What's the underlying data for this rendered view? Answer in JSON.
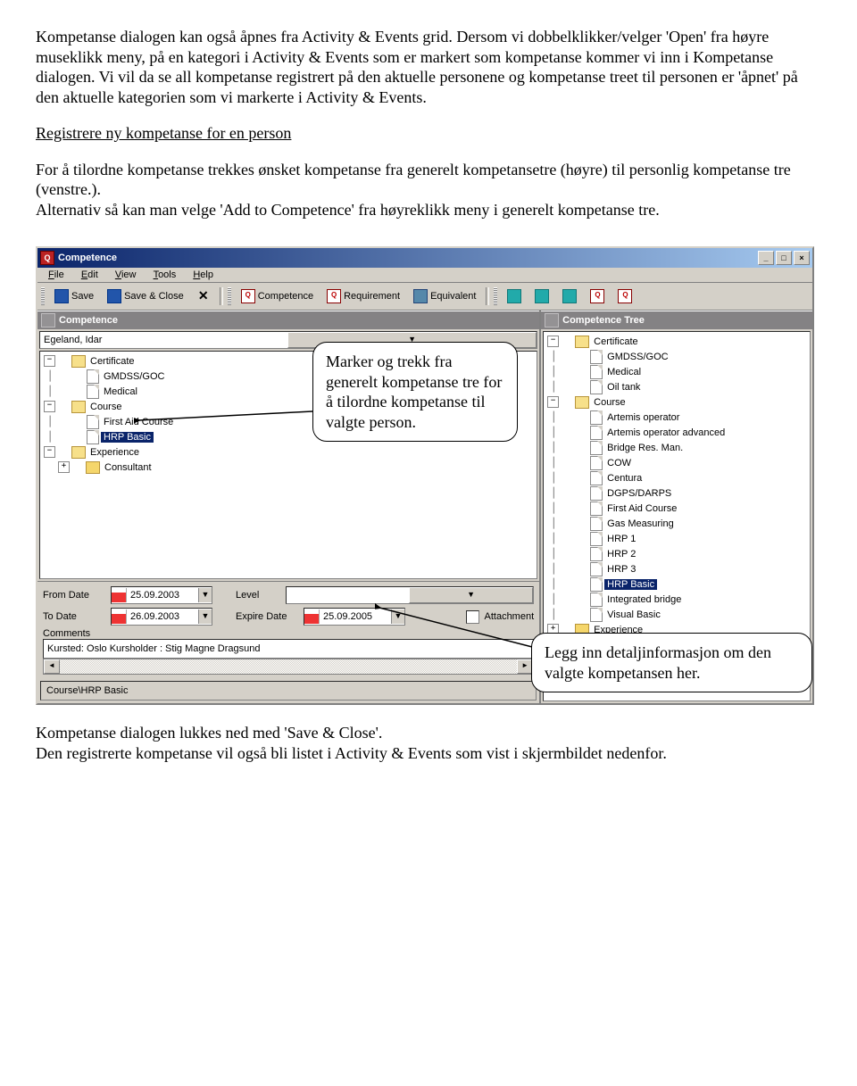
{
  "doc": {
    "p1": "Kompetanse dialogen kan også åpnes fra Activity & Events grid. Dersom vi dobbelklikker/velger 'Open' fra høyre museklikk meny, på en kategori i Activity & Events som er markert som kompetanse kommer vi inn i Kompetanse dialogen. Vi vil da se all kompetanse registrert på den aktuelle personene og kompetanse treet til personen er 'åpnet' på den aktuelle kategorien som vi markerte i Activity & Events.",
    "h1": "Registrere ny kompetanse for en person",
    "p2a": "For å tilordne kompetanse trekkes ønsket kompetanse fra generelt kompetansetre (høyre) til personlig kompetanse tre (venstre.).",
    "p2b": "Alternativ så kan man velge 'Add to Competence' fra høyreklikk meny i generelt kompetanse tre.",
    "p3a": "Kompetanse dialogen lukkes ned med 'Save & Close'.",
    "p3b": "Den registrerte kompetanse vil også bli listet i Activity & Events som vist i skjermbildet nedenfor."
  },
  "callout1": "Marker og trekk fra generelt kompetanse tre for å tilordne kompetanse til valgte person.",
  "callout2": "Legg inn detaljinformasjon om den valgte  kompetansen her.",
  "win": {
    "title": "Competence",
    "menu": {
      "file": "File",
      "edit": "Edit",
      "view": "View",
      "tools": "Tools",
      "help": "Help"
    },
    "toolbar": {
      "save": "Save",
      "save_close": "Save & Close",
      "competence": "Competence",
      "requirement": "Requirement",
      "equivalent": "Equivalent"
    },
    "left_header": "Competence",
    "right_header": "Competence Tree",
    "person": "Egeland, Idar",
    "left_tree": {
      "root_certificate": "Certificate",
      "gmdss": "GMDSS/GOC",
      "medical": "Medical",
      "root_course": "Course",
      "firstaid": "First Aid Course",
      "hrp_basic": "HRP Basic",
      "root_experience": "Experience",
      "consultant": "Consultant"
    },
    "right_tree": {
      "root_certificate": "Certificate",
      "gmdss": "GMDSS/GOC",
      "medical": "Medical",
      "oil": "Oil tank",
      "root_course": "Course",
      "artemis": "Artemis operator",
      "artemis_adv": "Artemis operator advanced",
      "bridge": "Bridge Res. Man.",
      "cow": "COW",
      "centura": "Centura",
      "dgps": "DGPS/DARPS",
      "firstaid": "First Aid Course",
      "gas": "Gas Measuring",
      "hrp1": "HRP 1",
      "hrp2": "HRP 2",
      "hrp3": "HRP 3",
      "hrp_basic": "HRP Basic",
      "integrated": "Integrated bridge",
      "visual": "Visual Basic",
      "root_experience": "Experience"
    },
    "details": {
      "from_label": "From Date",
      "from_value": "25.09.2003",
      "to_label": "To Date",
      "to_value": "26.09.2003",
      "level_label": "Level",
      "expire_label": "Expire Date",
      "expire_value": "25.09.2005",
      "attachment_label": "Attachment",
      "comments_label": "Comments",
      "comments_value": "Kursted: Oslo  Kursholder : Stig Magne Dragsund"
    },
    "status": "Course\\HRP Basic"
  }
}
